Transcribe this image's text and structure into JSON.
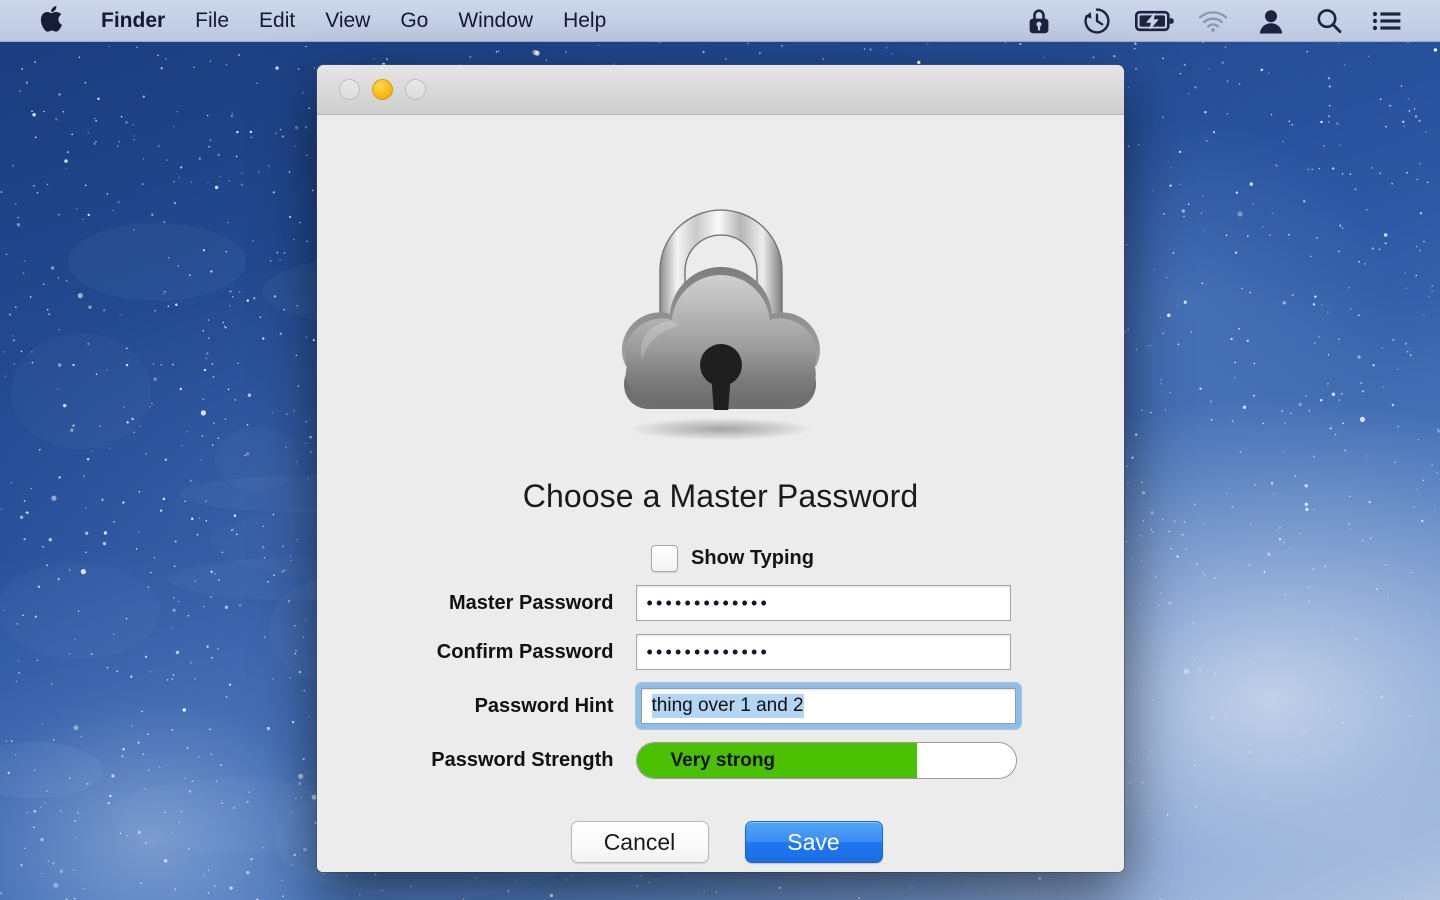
{
  "menubar": {
    "apple_icon": "apple-logo-icon",
    "items": [
      {
        "label": "Finder",
        "bold": true
      },
      {
        "label": "File",
        "bold": false
      },
      {
        "label": "Edit",
        "bold": false
      },
      {
        "label": "View",
        "bold": false
      },
      {
        "label": "Go",
        "bold": false
      },
      {
        "label": "Window",
        "bold": false
      },
      {
        "label": "Help",
        "bold": false
      }
    ],
    "status_icons": [
      {
        "name": "lock-icon",
        "dim": false
      },
      {
        "name": "time-machine-icon",
        "dim": false
      },
      {
        "name": "battery-charging-icon",
        "dim": false
      },
      {
        "name": "wifi-icon",
        "dim": true
      },
      {
        "name": "user-account-icon",
        "dim": false
      },
      {
        "name": "spotlight-search-icon",
        "dim": false
      },
      {
        "name": "notification-center-icon",
        "dim": false
      }
    ],
    "background_color": "#c6d1e7"
  },
  "dialog": {
    "traffic_lights": [
      {
        "name": "close-button",
        "state": "disabled",
        "color": "#e3e3e3"
      },
      {
        "name": "minimize-button",
        "state": "enabled",
        "color": "#fcbd1c"
      },
      {
        "name": "zoom-button",
        "state": "disabled",
        "color": "#e3e3e3"
      }
    ],
    "app_icon": "cloud-padlock-icon",
    "heading": "Choose a Master Password",
    "show_typing": {
      "label": "Show Typing",
      "checked": false
    },
    "fields": [
      {
        "label": "Master Password",
        "type": "password",
        "value": "•••••••••••••",
        "char_count": 13,
        "focused": false
      },
      {
        "label": "Confirm Password",
        "type": "password",
        "value": "•••••••••••••",
        "char_count": 13,
        "focused": false
      }
    ],
    "hint_field": {
      "label": "Password Hint",
      "value": "thing over 1 and 2",
      "focused": true,
      "text_selected": true,
      "focus_ring_color": "#8fbdea",
      "selection_color": "#b3d6f6"
    },
    "strength": {
      "label": "Password Strength",
      "value_text": "Very strong",
      "percent": 74,
      "fill_color": "#4bc003"
    },
    "buttons": [
      {
        "name": "cancel-button",
        "label": "Cancel",
        "primary": false
      },
      {
        "name": "save-button",
        "label": "Save",
        "primary": true,
        "color": "#2b80ef"
      }
    ]
  }
}
